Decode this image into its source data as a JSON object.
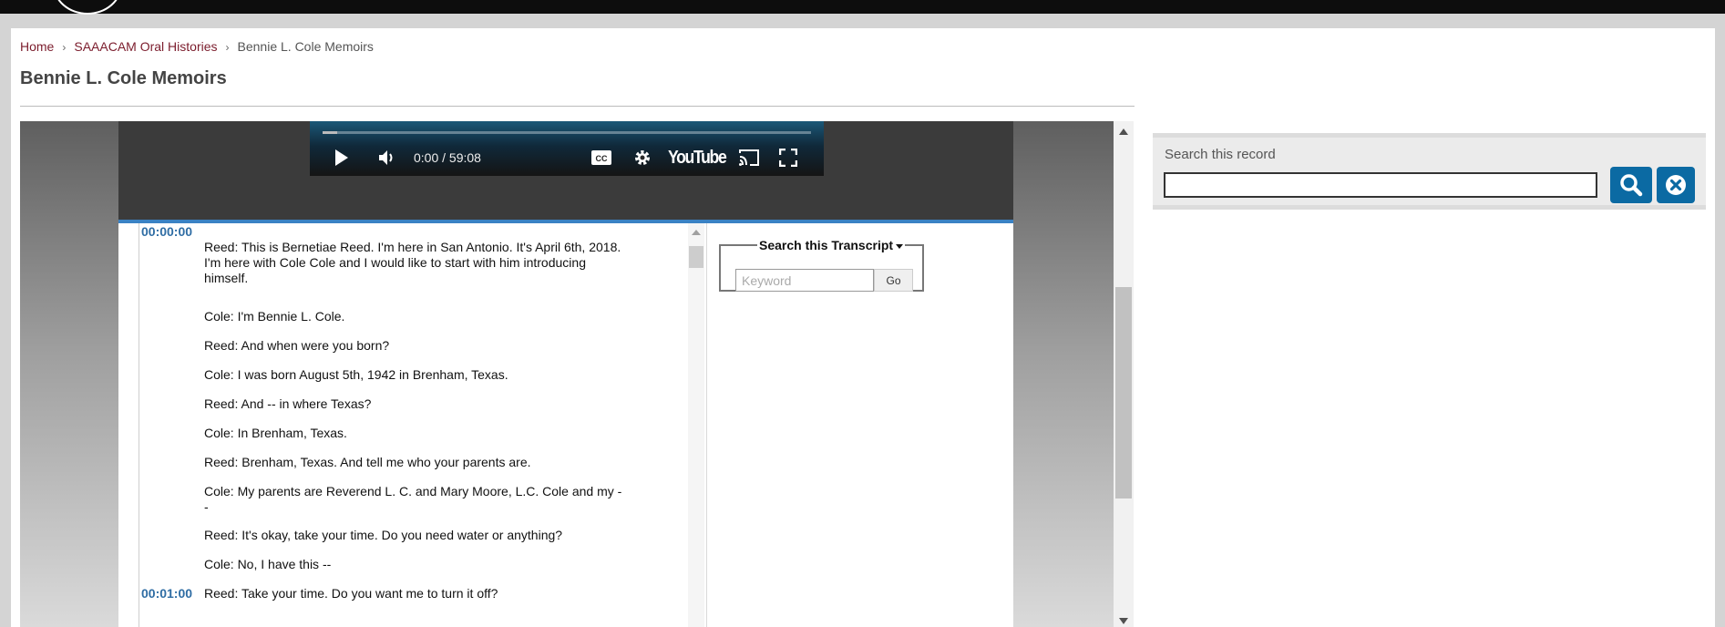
{
  "breadcrumb": {
    "home": "Home",
    "collection": "SAAACAM Oral Histories",
    "current": "Bennie L. Cole Memoirs",
    "separator": "›"
  },
  "page_title": "Bennie L. Cole Memoirs",
  "video_player": {
    "time": "0:00 / 59:08",
    "brand": "YouTube",
    "progress_fraction": 0.0
  },
  "transcript": {
    "timestamps": [
      "00:00:00",
      "00:01:00"
    ],
    "lines": [
      "Reed: This is Bernetiae Reed. I'm here in San Antonio. It's April 6th, 2018. I'm here with Cole Cole and I would like to start with him introducing himself.",
      "Cole: I'm Bennie L. Cole.",
      "Reed: And when were you born?",
      "Cole: I was born August 5th, 1942 in Brenham, Texas.",
      "Reed: And -- in where Texas?",
      "Cole: In Brenham, Texas.",
      "Reed: Brenham, Texas. And tell me who your parents are.",
      "Cole: My parents are Reverend L. C. and Mary Moore, L.C. Cole and my --",
      "Reed: It's okay, take your time. Do you need water or anything?",
      "Cole: No, I have this --",
      "Reed: Take your time. Do you want me to turn it off?"
    ]
  },
  "transcript_search": {
    "legend": "Search this Transcript",
    "placeholder": "Keyword",
    "go_label": "Go"
  },
  "record_search": {
    "label": "Search this record",
    "value": ""
  },
  "colors": {
    "link": "#7b1c2c",
    "timestamp": "#2f6da4",
    "accent_button": "#0b6aa3",
    "player_border": "#3a82c4"
  }
}
